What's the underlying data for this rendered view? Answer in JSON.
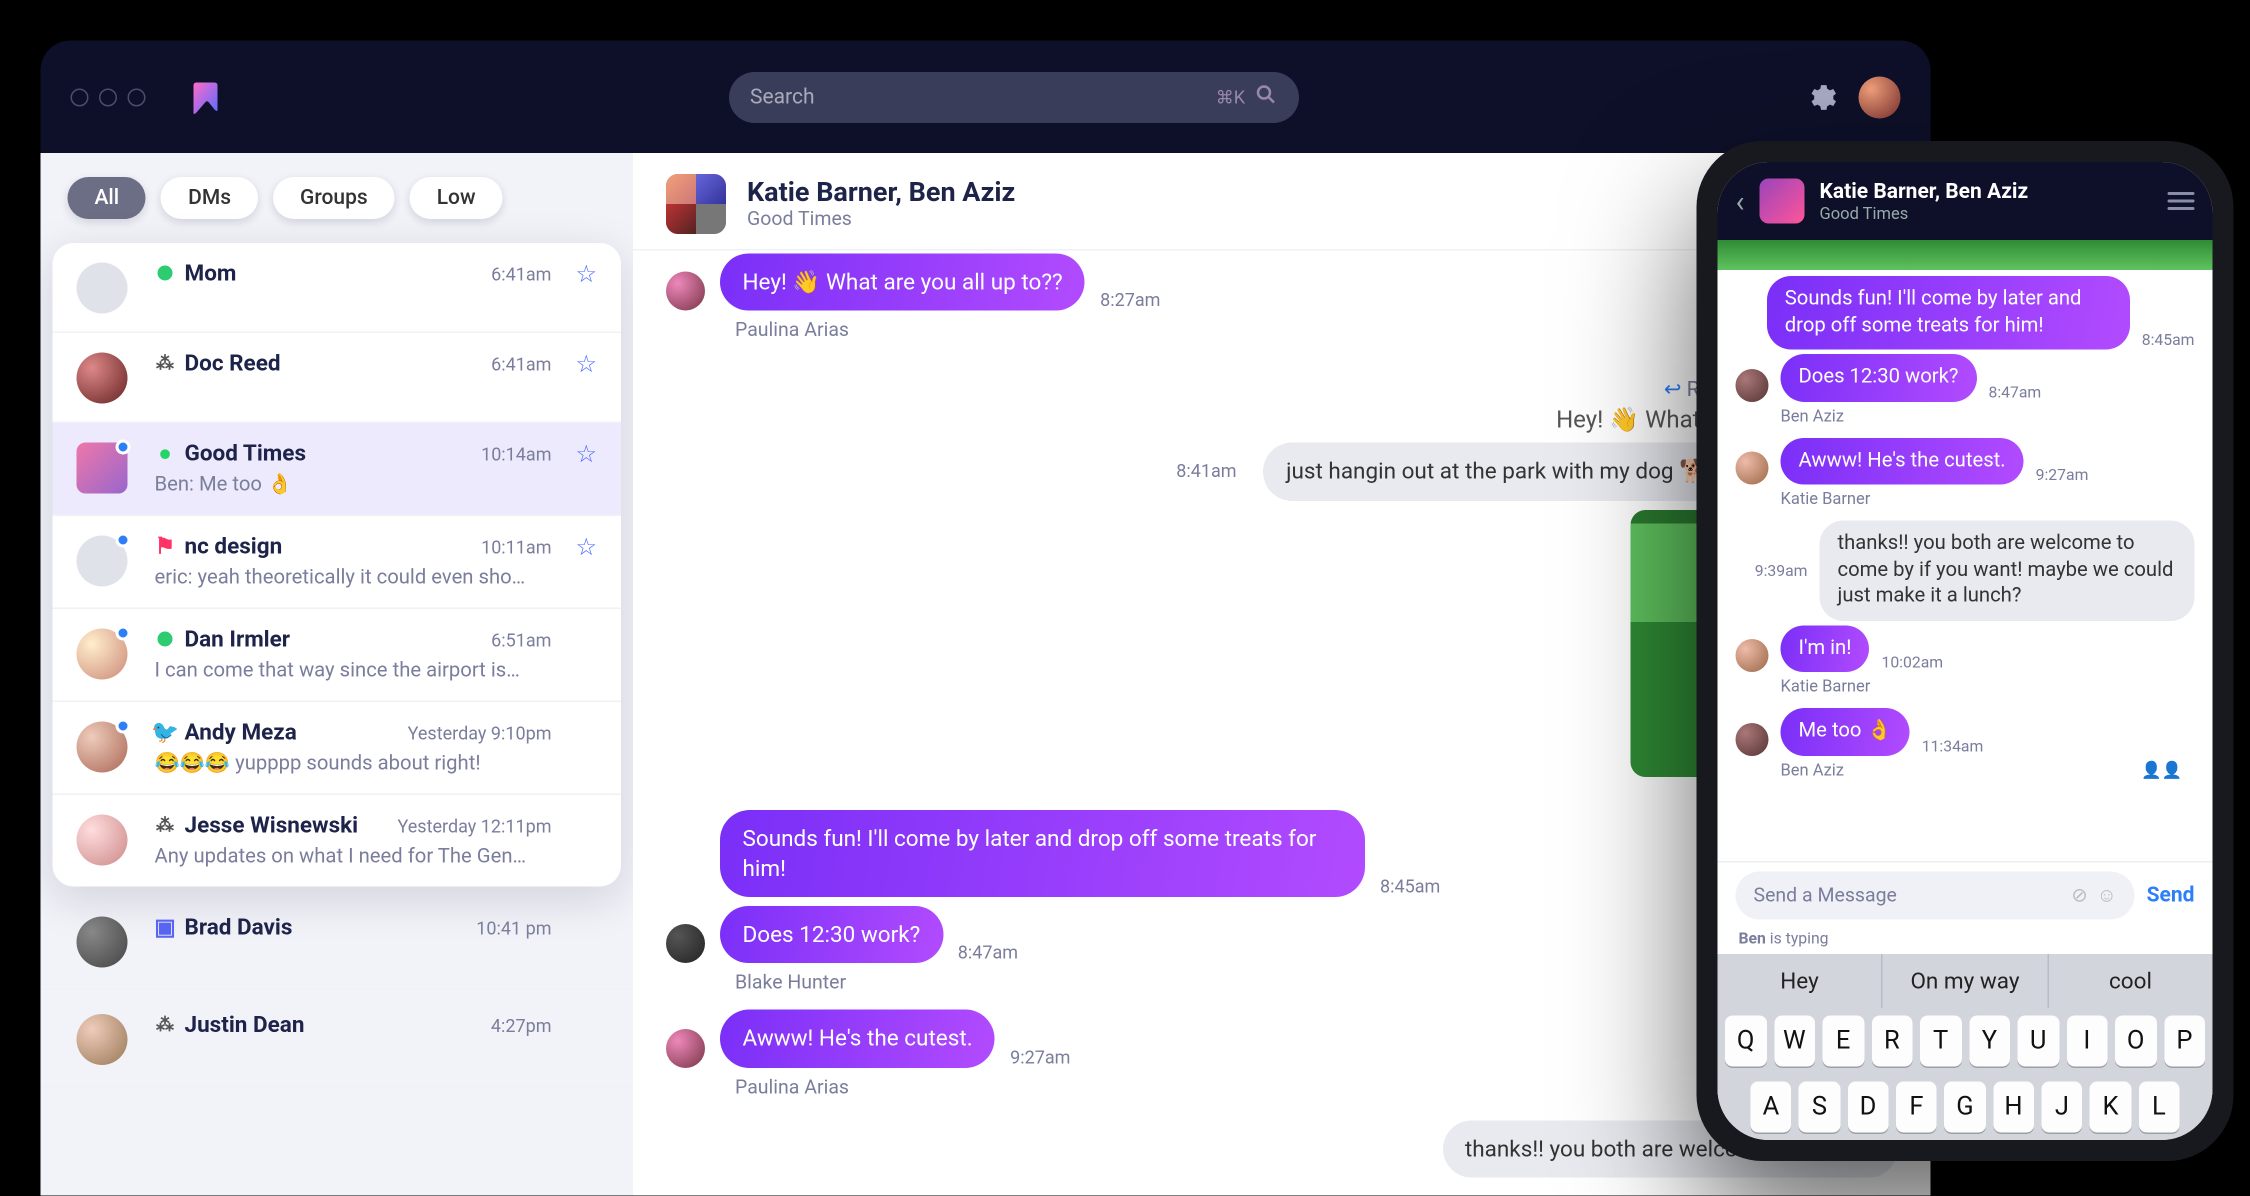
{
  "search": {
    "placeholder": "Search",
    "shortcut": "⌘K"
  },
  "tabs": {
    "all": "All",
    "dms": "DMs",
    "groups": "Groups",
    "low": "Low"
  },
  "convs": [
    {
      "name": "Mom",
      "time": "6:41am",
      "preview": ""
    },
    {
      "name": "Doc Reed",
      "time": "6:41am",
      "preview": ""
    },
    {
      "name": "Good Times",
      "time": "10:14am",
      "preview": "Ben: Me too 👌"
    },
    {
      "name": "nc design",
      "time": "10:11am",
      "preview": "eric: yeah theoretically it could even sho…"
    },
    {
      "name": "Dan Irmler",
      "time": "6:51am",
      "preview": "I can come that way since the airport is…"
    },
    {
      "name": "Andy Meza",
      "time": "Yesterday 9:10pm",
      "preview": "😂😂😂 yupppp sounds about right!"
    },
    {
      "name": "Jesse Wisnewski",
      "time": "Yesterday 12:11pm",
      "preview": "Any updates on what I need for The Gen…"
    }
  ],
  "below": [
    {
      "name": "Brad Davis",
      "time": "10:41 pm"
    },
    {
      "name": "Justin Dean",
      "time": "4:27pm"
    }
  ],
  "chat": {
    "title": "Katie Barner, Ben Aziz",
    "subtitle": "Good Times",
    "reply_to": "Reply to Paulina Arias:",
    "m1": "Hey! 👋 What are you all up to??",
    "m1_sender": "Paulina Arias",
    "m1_time": "8:27am",
    "m2": "Hey! 👋 What are you all up to??",
    "m3": "just hangin out at the park with my dog 🐕 about you guys?",
    "m3_time": "8:41am",
    "m4": "Sounds fun! I'll come by later and drop off some treats for him!",
    "m4_time": "8:45am",
    "m5": "Does 12:30 work?",
    "m5_sender": "Blake Hunter",
    "m5_time": "8:47am",
    "m6": "Awww! He's the cutest.",
    "m6_sender": "Paulina Arias",
    "m6_time": "9:27am",
    "m7": "thanks!! you both are welcome to come b"
  },
  "phone": {
    "title": "Katie Barner, Ben Aziz",
    "subtitle": "Good Times",
    "p1": "Sounds fun! I'll come by later and drop off some treats for him!",
    "p1_time": "8:45am",
    "p2": "Does 12:30 work?",
    "p2_time": "8:47am",
    "p2_sender": "Ben Aziz",
    "p3": "Awww! He's the cutest.",
    "p3_time": "9:27am",
    "p3_sender": "Katie Barner",
    "p4": "thanks!! you both are welcome to come by if you want! maybe we could just make it a lunch?",
    "p4_time": "9:39am",
    "p5": "I'm in!",
    "p5_time": "10:02am",
    "p5_sender": "Katie Barner",
    "p6": "Me too 👌",
    "p6_time": "11:34am",
    "p6_sender": "Ben Aziz",
    "compose_placeholder": "Send a Message",
    "send": "Send",
    "typing": "Ben is typing",
    "suggest": [
      "Hey",
      "On my way",
      "cool"
    ],
    "row1": [
      "Q",
      "W",
      "E",
      "R",
      "T",
      "Y",
      "U",
      "I",
      "O",
      "P"
    ],
    "row2": [
      "A",
      "S",
      "D",
      "F",
      "G",
      "H",
      "J",
      "K",
      "L"
    ]
  }
}
